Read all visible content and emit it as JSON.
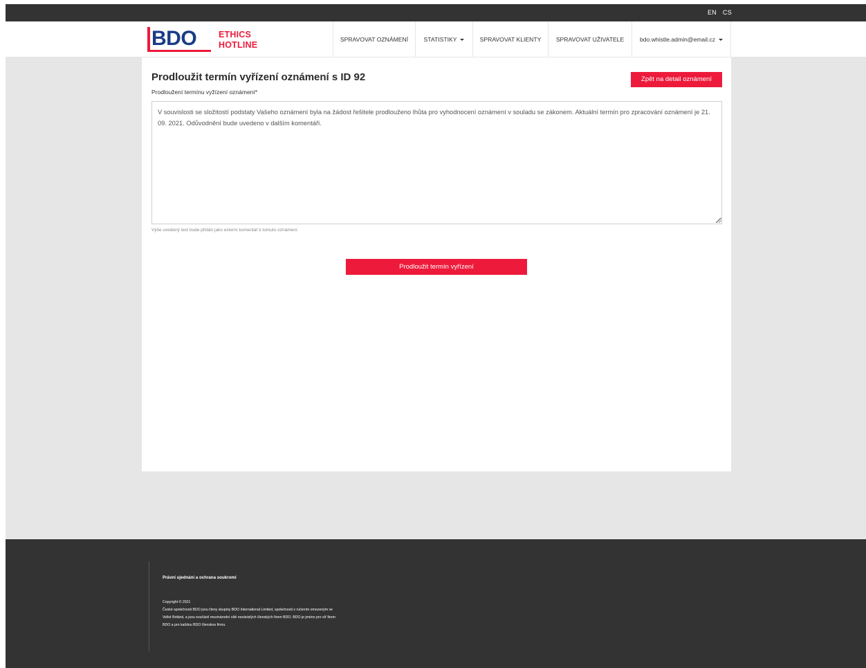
{
  "topbar": {
    "languages": [
      "EN",
      "CS"
    ]
  },
  "brand": {
    "logo_text": "BDO",
    "line1": "ETHICS",
    "line2": "HOTLINE"
  },
  "nav": {
    "items": [
      {
        "label": "SPRAVOVAT OZNÁMENÍ"
      },
      {
        "label": "STATISTIKY"
      },
      {
        "label": "SPRAVOVAT KLIENTY"
      },
      {
        "label": "SPRAVOVAT UŽIVATELE"
      },
      {
        "label": "bdo.whistle.admin@email.cz"
      }
    ]
  },
  "main": {
    "title": "Prodloužit termín vyřízení oznámení s ID 92",
    "back_button": "Zpět na detail oznámení",
    "field_label": "Prodloužení termínu vyžízení oznámení*",
    "textarea_value": "V souvislosti se složitostí podstaty Vašeho oznámení byla na žádost řešitele prodlouženo lhůta pro vyhodnocení oznámení v souladu se zákonem. Aktuální termín pro zpracování oznámení je 21. 09. 2021. Odůvodnění bude uvedeno v dalším komentáři.",
    "help_text": "Výše uvedený text bude přidán jako externí komentář k tomuto oznámení.",
    "submit_button": "Prodloužit termín vyřízení"
  },
  "footer": {
    "legal_link": "Právní ujednání a ochrana soukromí",
    "copyright": "Copyright © 2021",
    "line1": "České společnosti BDO jsou členy skupiny BDO International Limited, společnosti s ručením omezeným ve",
    "line2": "Velké Británii, a jsou součástí mezinárodní sítě nezávislých členských firem BDO. BDO je jméno pro síť firem",
    "line3": "BDO a pro každou BDO členskou firmu."
  },
  "colors": {
    "accent": "#ed1a3b",
    "brand_blue": "#1a3c87",
    "dark": "#333333",
    "background": "#e6e6e6"
  }
}
